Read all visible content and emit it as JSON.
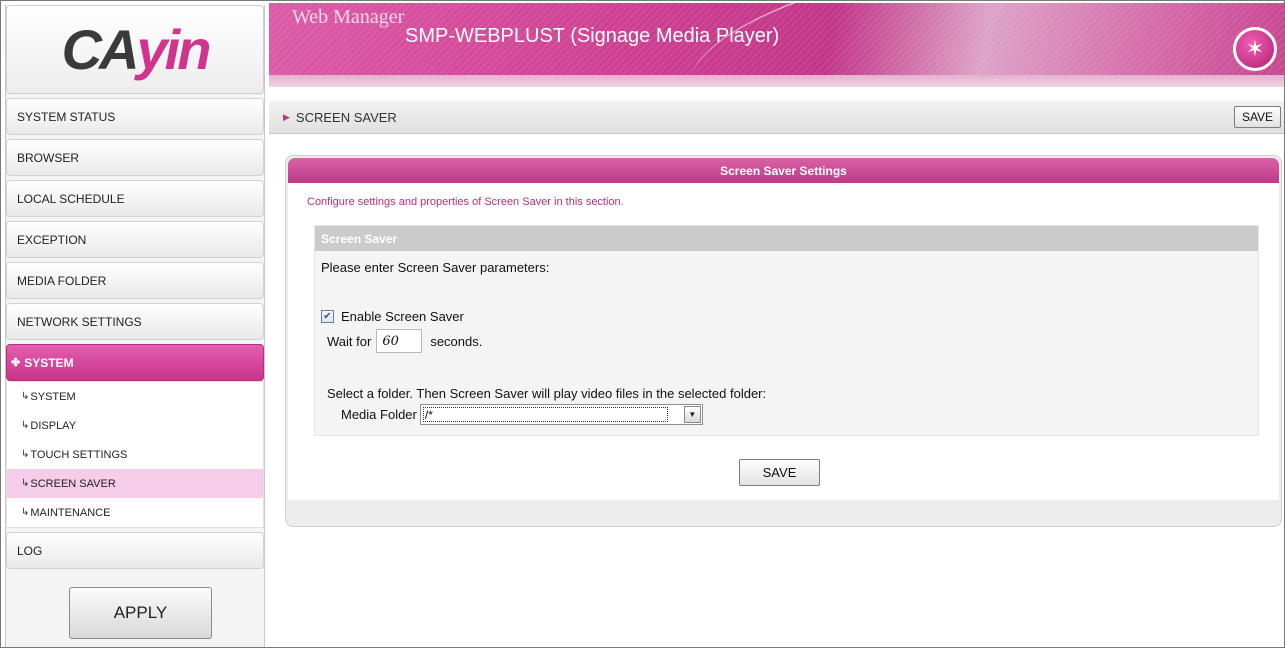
{
  "brand": {
    "logo_part1": "CA",
    "logo_part2": "yin",
    "logo_color_dark": "#3a3a3a",
    "logo_color_accent": "#d0348e"
  },
  "header": {
    "app_title": "Web Manager",
    "device_name": "SMP-WEBPLUST (Signage Media Player)",
    "icon": "magic-wand-icon",
    "accent_color": "#c23587"
  },
  "sidebar": {
    "items": [
      {
        "label": "SYSTEM STATUS"
      },
      {
        "label": "BROWSER"
      },
      {
        "label": "LOCAL SCHEDULE"
      },
      {
        "label": "EXCEPTION"
      },
      {
        "label": "MEDIA FOLDER"
      },
      {
        "label": "NETWORK SETTINGS"
      },
      {
        "label": "SYSTEM",
        "active": true,
        "icon": "sparkle-icon"
      }
    ],
    "sub_items": [
      {
        "label": "SYSTEM"
      },
      {
        "label": "DISPLAY"
      },
      {
        "label": "TOUCH SETTINGS"
      },
      {
        "label": "SCREEN SAVER",
        "active": true
      },
      {
        "label": "MAINTENANCE"
      }
    ],
    "log_label": "LOG",
    "apply_label": "APPLY"
  },
  "breadcrumb": {
    "label": "SCREEN SAVER",
    "save_label": "SAVE"
  },
  "panel": {
    "title": "Screen Saver Settings",
    "intro": "Configure settings and properties of Screen Saver in this section.",
    "section_title": "Screen Saver",
    "prompt": "Please enter Screen Saver parameters:",
    "enable_label": "Enable Screen Saver",
    "enable_checked": true,
    "wait_prefix": "Wait for",
    "wait_value": "60",
    "wait_suffix": "seconds.",
    "folder_note": "Select a folder. Then Screen Saver will play video files in the selected folder:",
    "folder_label": "Media Folder",
    "folder_value": "/*",
    "save_label": "SAVE"
  }
}
